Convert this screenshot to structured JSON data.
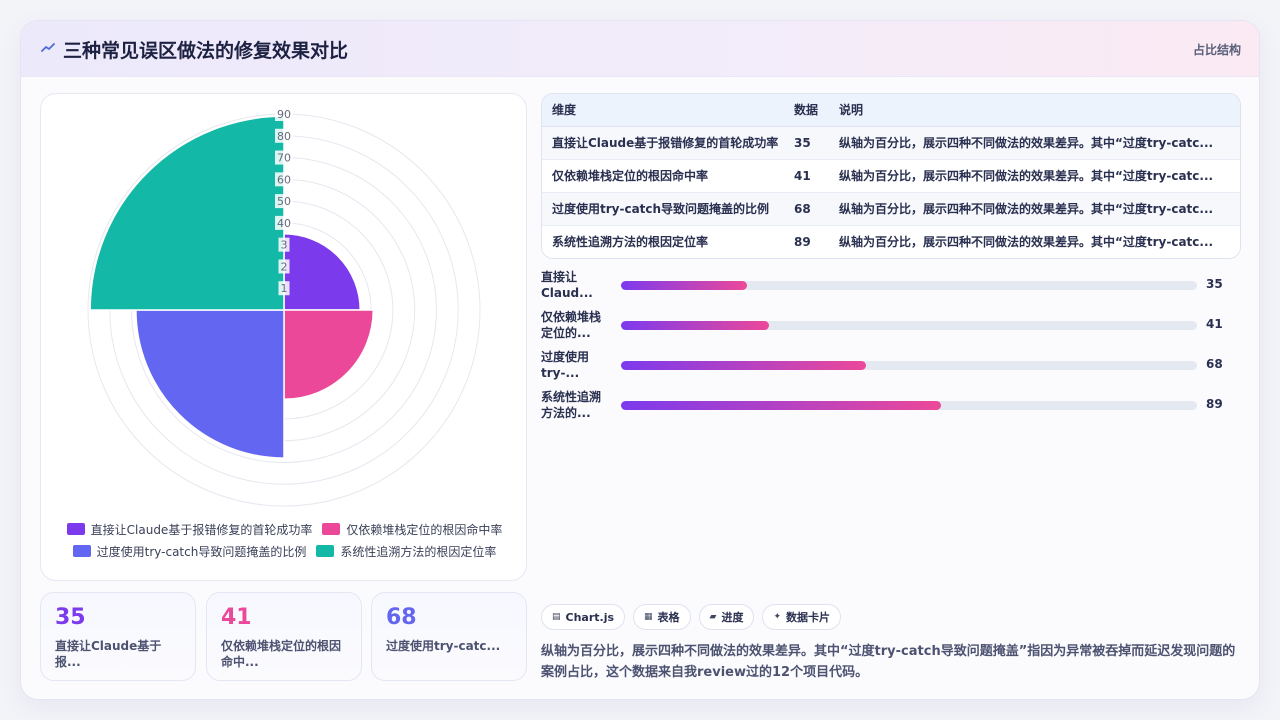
{
  "header": {
    "icon": "line-chart-icon",
    "title": "三种常见误区做法的修复效果对比",
    "tag": "占比结构"
  },
  "colors": {
    "purple": "#7c3aed",
    "pink": "#ec4899",
    "indigo": "#6366f1",
    "teal": "#14b8a6"
  },
  "chart_data": {
    "type": "polarArea",
    "categories": [
      "直接让Claude基于报错修复的首轮成功率",
      "仅依赖堆栈定位的根因命中率",
      "过度使用try-catch导致问题掩盖的比例",
      "系统性追溯方法的根因定位率"
    ],
    "values": [
      35,
      41,
      68,
      89
    ],
    "colors": [
      "#7c3aed",
      "#ec4899",
      "#6366f1",
      "#14b8a6"
    ],
    "rlim": [
      0,
      90
    ],
    "ticks": [
      10,
      20,
      30,
      40,
      50,
      60,
      70,
      80,
      90
    ],
    "tick_labels": [
      "1",
      "2",
      "3",
      "40",
      "50",
      "60",
      "70",
      "80",
      "90"
    ],
    "legend_position": "bottom"
  },
  "legend": [
    {
      "label": "直接让Claude基于报错修复的首轮成功率",
      "color": "#7c3aed"
    },
    {
      "label": "仅依赖堆栈定位的根因命中率",
      "color": "#ec4899"
    },
    {
      "label": "过度使用try-catch导致问题掩盖的比例",
      "color": "#6366f1"
    },
    {
      "label": "系统性追溯方法的根因定位率",
      "color": "#14b8a6"
    }
  ],
  "stats": [
    {
      "value": "35",
      "label": "直接让Claude基于报...",
      "color": "#7c3aed"
    },
    {
      "value": "41",
      "label": "仅依赖堆栈定位的根因命中...",
      "color": "#ec4899"
    },
    {
      "value": "68",
      "label": "过度使用try-catc...",
      "color": "#6366f1"
    }
  ],
  "table": {
    "headers": [
      "维度",
      "数据",
      "说明"
    ],
    "rows": [
      [
        "直接让Claude基于报错修复的首轮成功率",
        "35",
        "纵轴为百分比，展示四种不同做法的效果差异。其中“过度try-catc..."
      ],
      [
        "仅依赖堆栈定位的根因命中率",
        "41",
        "纵轴为百分比，展示四种不同做法的效果差异。其中“过度try-catc..."
      ],
      [
        "过度使用try-catch导致问题掩盖的比例",
        "68",
        "纵轴为百分比，展示四种不同做法的效果差异。其中“过度try-catc..."
      ],
      [
        "系统性追溯方法的根因定位率",
        "89",
        "纵轴为百分比，展示四种不同做法的效果差异。其中“过度try-catc..."
      ]
    ]
  },
  "progress": {
    "max": 90,
    "items": [
      {
        "label": "直接让Claud...",
        "value": 35
      },
      {
        "label": "仅依赖堆栈定位的...",
        "value": 41
      },
      {
        "label": "过度使用try-...",
        "value": 68
      },
      {
        "label": "系统性追溯方法的...",
        "value": 89
      }
    ]
  },
  "chips": [
    {
      "icon": "▤",
      "label": "Chart.js"
    },
    {
      "icon": "▦",
      "label": "表格"
    },
    {
      "icon": "▰",
      "label": "进度"
    },
    {
      "icon": "✦",
      "label": "数据卡片"
    }
  ],
  "description": "纵轴为百分比，展示四种不同做法的效果差异。其中“过度try-catch导致问题掩盖”指因为异常被吞掉而延迟发现问题的案例占比，这个数据来自我review过的12个项目代码。"
}
